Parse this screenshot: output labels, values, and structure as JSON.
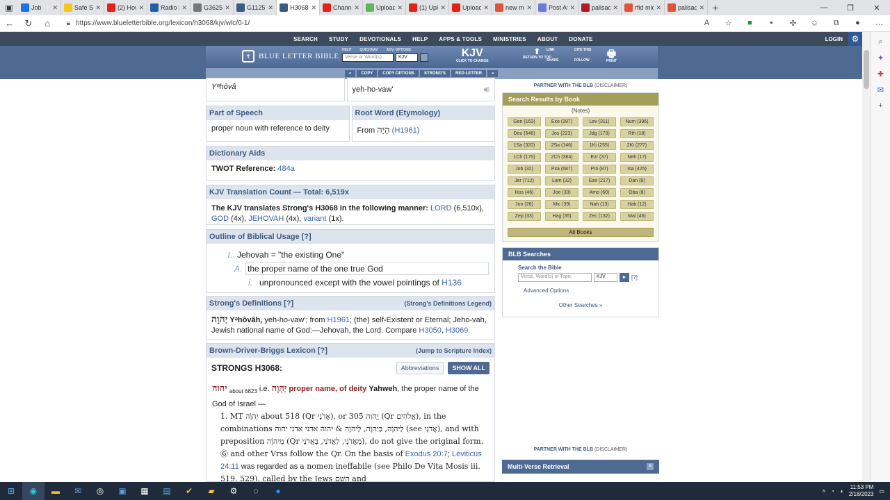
{
  "browser": {
    "tabs": [
      {
        "label": "Job",
        "color": "#1a73e8"
      },
      {
        "label": "Safe Se",
        "color": "#f5c518"
      },
      {
        "label": "(2) How",
        "color": "#e62117"
      },
      {
        "label": "Radio F",
        "color": "#1f5fa8"
      },
      {
        "label": "G3625",
        "color": "#777777"
      },
      {
        "label": "G1125",
        "color": "#3d5a80"
      },
      {
        "label": "H3068",
        "color": "#3d5a80"
      },
      {
        "label": "Channe",
        "color": "#e62117"
      },
      {
        "label": "Upload",
        "color": "#5bb95b"
      },
      {
        "label": "(1) Uplo",
        "color": "#e62117"
      },
      {
        "label": "Upload",
        "color": "#e62117"
      },
      {
        "label": "new me",
        "color": "#e0533a"
      },
      {
        "label": "Post Att",
        "color": "#6a7bd6"
      },
      {
        "label": "palisade",
        "color": "#b11b22"
      },
      {
        "label": "rfid mic",
        "color": "#e0533a"
      },
      {
        "label": "palisade",
        "color": "#e0533a"
      }
    ],
    "active_tab": 6,
    "url": "https://www.blueletterbible.org/lexicon/h3068/kjv/wlc/0-1/"
  },
  "site": {
    "nav": [
      "SEARCH",
      "STUDY",
      "DEVOTIONALS",
      "HELP",
      "APPS & TOOLS",
      "MINISTRIES",
      "ABOUT",
      "DONATE"
    ],
    "login": "LOGIN",
    "logo_text": "BLUE LETTER BIBLE",
    "search_labels": [
      "HELP",
      "QUICKNAV",
      "ADV. OPTIONS"
    ],
    "search_placeholder": "Verse or Word(s)",
    "version": "KJV",
    "kjv_big": "KJV",
    "kjv_click": "CLICK TO CHANGE",
    "return_top": "RETURN TO TOP",
    "tools": [
      "LINK",
      "CITE THIS",
      "SHARE",
      "FOLLOW"
    ],
    "print": "PRINT",
    "subbar": [
      "COPY",
      "COPY OPTIONS",
      "STRONG'S",
      "RED-LETTER"
    ]
  },
  "lexicon": {
    "translit": "Yᵊhōvâ",
    "pronunciation": "yeh-ho-vaw'",
    "pos_label": "Part of Speech",
    "pos_value": "proper noun with reference to deity",
    "root_label": "Root Word (Etymology)",
    "root_from": "From",
    "root_hebrew": "הָיָה",
    "root_link": "(H1961)",
    "dict_label": "Dictionary Aids",
    "twot_label": "TWOT Reference:",
    "twot_value": "484a",
    "kjv_count_label": "KJV Translation Count — Total: 6,519x",
    "kjv_translates": "The KJV translates Strong's H3068 in the following manner:",
    "kjv_items": [
      {
        "word": "LORD",
        "count": "(6,510x),"
      },
      {
        "word": "GOD",
        "count": "(4x),"
      },
      {
        "word": "JEHOVAH",
        "count": "(4x),"
      },
      {
        "word": "variant",
        "count": "(1x)."
      }
    ],
    "outline_label": "Outline of Biblical Usage [?]",
    "outline": [
      {
        "num": "I.",
        "text": "Jehovah = \"the existing One\""
      },
      {
        "num": "A.",
        "text": "the proper name of the one true God"
      },
      {
        "num": "i.",
        "text": "unpronounced except with the vowel pointings of",
        "link": "H136"
      }
    ],
    "strongs_label": "Strong's Definitions [?]",
    "strongs_legend": "(Strong's Definitions Legend)",
    "strongs_hebrew": "יְהֹוָה",
    "strongs_translit": "Yᵊhôvâh,",
    "strongs_text1": "yeh-ho-vaw'; from",
    "strongs_link1": "H1961",
    "strongs_text2": "; (the) self-Existent or Eternal; Jeho-vah, Jewish national name of God:—Jehovah, the Lord. Compare",
    "strongs_link2": "H3050",
    "strongs_link3": "H3069.",
    "bdb_label": "Brown-Driver-Briggs Lexicon [?]",
    "bdb_jump": "(Jump to Scripture Index)",
    "bdb_title": "STRONGS H3068:",
    "bdb_abbrev": "Abbreviations",
    "bdb_showall": "SHOW ALL",
    "bdb_line1_heb": "יהוה",
    "bdb_line1_about": "about 6823",
    "bdb_line1_ie": "i.e.",
    "bdb_line1_heb2": "יַהְוֶה",
    "bdb_line1_red": "proper name, of deity",
    "bdb_line1_bold": "Yahweh",
    "bdb_line1_rest": ", the proper name of the God of Israel —",
    "bdb_para": "1. MT יְהוָֹה about 518 (Qr אֲדֹנָי), or יֱהֹוִה 305 (Qr אֱלֹהִים), in the combinations לַיהוָֹה, בַּיהוָֹה, לַיהוָֹה & יהוה אדני אדני יהוה (see אֲדֹנָי), and with preposition מֵיהוָֹה (Qr מֵאֲדֹנָי, לַאֲדֹנָי, בַּאֲדֹנָי), do not give the original form. Ⓖ and other Vrss follow the Qr. On the basis of",
    "bdb_link1": "Exodus 20:7",
    "bdb_link2": "Leviticus 24:11",
    "bdb_para2": "was regarded as",
    "bdb_para3": "a nomen ineffabile (see Philo De Vita Mosis iii. 519, 529), called by the Jews הַשֵּׁם and"
  },
  "sidebar": {
    "partner": "PARTNER WITH THE BLB",
    "disclaimer": "(DISCLAIMER)",
    "sbb_title": "Search Results by Book",
    "notes": "(Notes)",
    "books": [
      "Gen (163)",
      "Exo (397)",
      "Lev (311)",
      "Num (396)",
      "Deu (548)",
      "Jos (223)",
      "Jdg (173)",
      "Rth (18)",
      "1Sa (320)",
      "2Sa (146)",
      "1Ki (255)",
      "2Ki (277)",
      "1Ch (175)",
      "2Ch (384)",
      "Ezr (37)",
      "Neh (17)",
      "Job (32)",
      "Psa (687)",
      "Pro (87)",
      "Isa (425)",
      "Jer (712)",
      "Lam (32)",
      "Eze (217)",
      "Dan (8)",
      "Hos (46)",
      "Joe (33)",
      "Amo (60)",
      "Oba (6)",
      "Jon (26)",
      "Mic (39)",
      "Nah (13)",
      "Hab (12)",
      "Zep (33)",
      "Hag (35)",
      "Zec (132)",
      "Mal (46)"
    ],
    "all_books": "All Books",
    "blb_searches": "BLB Searches",
    "search_bible": "Search the Bible",
    "search_placeholder": "Verse, Word(s) or Topic",
    "version": "KJV",
    "help": "[?]",
    "advanced": "Advanced Options",
    "other": "Other Searches »",
    "multi_verse": "Multi-Verse Retrieval"
  },
  "taskbar": {
    "time": "11:53 PM",
    "date": "2/18/2023"
  }
}
